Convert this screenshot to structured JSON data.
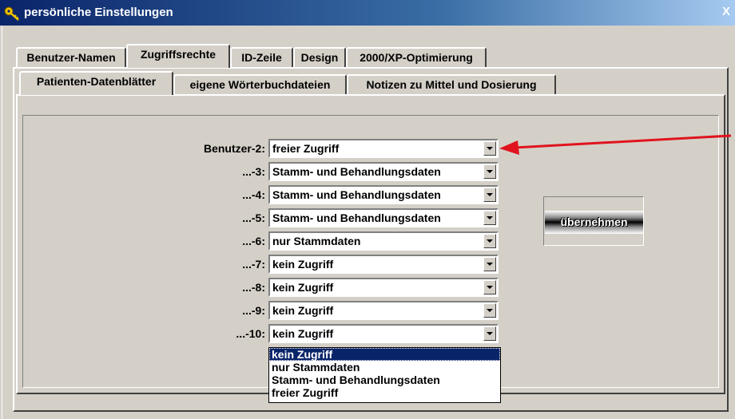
{
  "window": {
    "title": "persönliche Einstellungen",
    "close_label": "X"
  },
  "tabs_outer": [
    {
      "label": "Benutzer-Namen"
    },
    {
      "label": "Zugriffsrechte"
    },
    {
      "label": "ID-Zeile"
    },
    {
      "label": "Design"
    },
    {
      "label": "2000/XP-Optimierung"
    }
  ],
  "tabs_outer_active": "Zugriffsrechte",
  "tabs_inner": [
    {
      "label": "Patienten-Datenblätter"
    },
    {
      "label": "eigene Wörterbuchdateien"
    },
    {
      "label": "Notizen zu Mittel und Dosierung"
    }
  ],
  "tabs_inner_active": "Patienten-Datenblätter",
  "rows": [
    {
      "label": "Benutzer-2:",
      "value": "freier Zugriff"
    },
    {
      "label": "...-3:",
      "value": "Stamm- und Behandlungsdaten"
    },
    {
      "label": "...-4:",
      "value": "Stamm- und Behandlungsdaten"
    },
    {
      "label": "...-5:",
      "value": "Stamm- und Behandlungsdaten"
    },
    {
      "label": "...-6:",
      "value": "nur Stammdaten"
    },
    {
      "label": "...-7:",
      "value": "kein Zugriff"
    },
    {
      "label": "...-8:",
      "value": "kein Zugriff"
    },
    {
      "label": "...-9:",
      "value": "kein Zugriff"
    },
    {
      "label": "...-10:",
      "value": "kein Zugriff"
    }
  ],
  "dropdown_options": [
    "kein Zugriff",
    "nur Stammdaten",
    "Stamm- und Behandlungsdaten",
    "freier Zugriff"
  ],
  "dropdown_selected": "kein Zugriff",
  "apply_button": "übernehmen",
  "colors": {
    "annotation_arrow": "#e0141e",
    "selection": "#0a246a",
    "titlebar": "#0a246a"
  }
}
